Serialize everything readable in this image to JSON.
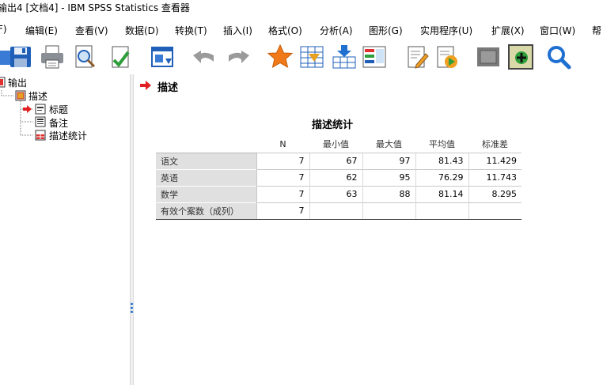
{
  "window": {
    "title": "输出4 [文档4] - IBM SPSS Statistics 查看器"
  },
  "menu": [
    "F)",
    "编辑(E)",
    "查看(V)",
    "数据(D)",
    "转换(T)",
    "插入(I)",
    "格式(O)",
    "分析(A)",
    "图形(G)",
    "实用程序(U)",
    "扩展(X)",
    "窗口(W)",
    "帮"
  ],
  "outline": {
    "root": "输出",
    "procedure": "描述",
    "items": [
      "标题",
      "备注",
      "描述统计"
    ]
  },
  "content": {
    "heading": "描述",
    "table": {
      "title": "描述统计",
      "columns": [
        "N",
        "最小值",
        "最大值",
        "平均值",
        "标准差"
      ],
      "rows": [
        {
          "label": "语文",
          "values": [
            "7",
            "67",
            "97",
            "81.43",
            "11.429"
          ]
        },
        {
          "label": "英语",
          "values": [
            "7",
            "62",
            "95",
            "76.29",
            "11.743"
          ]
        },
        {
          "label": "数学",
          "values": [
            "7",
            "63",
            "88",
            "81.14",
            "8.295"
          ]
        },
        {
          "label": "有效个案数（成列）",
          "values": [
            "7",
            "",
            "",
            "",
            ""
          ]
        }
      ]
    }
  },
  "colors": {
    "accent": "#1f6fd1",
    "arrow": "#e02020",
    "rowhead_bg": "#e0e0e0"
  }
}
